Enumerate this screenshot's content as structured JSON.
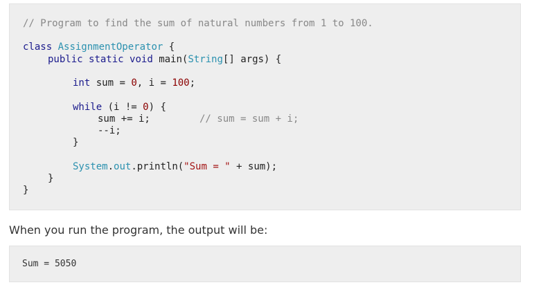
{
  "code": {
    "comment_header": "// Program to find the sum of natural numbers from 1 to 100.",
    "kw_class": "class",
    "class_name": "AssignmentOperator",
    "open_brace": " {",
    "kw_public": "public",
    "kw_static": "static",
    "kw_void": "void",
    "method_name": "main(",
    "type_string": "String",
    "params": "[] args) {",
    "kw_int": "int",
    "decl_sum": " sum = ",
    "num_zero": "0",
    "decl_i": ", i = ",
    "num_hundred": "100",
    "semicolon": ";",
    "kw_while": "while",
    "while_open": " (i != ",
    "while_close": ") {",
    "stmt_add": "sum += i;",
    "inline_comment": "// sum = sum + i;",
    "stmt_dec": "--i;",
    "close_brace": "}",
    "sys": "System",
    "dot1": ".",
    "out": "out",
    "println": ".println(",
    "str_literal": "\"Sum = \"",
    "println_tail": " + sum);"
  },
  "prose_text": "When you run the program, the output will be:",
  "output_text": "Sum = 5050"
}
